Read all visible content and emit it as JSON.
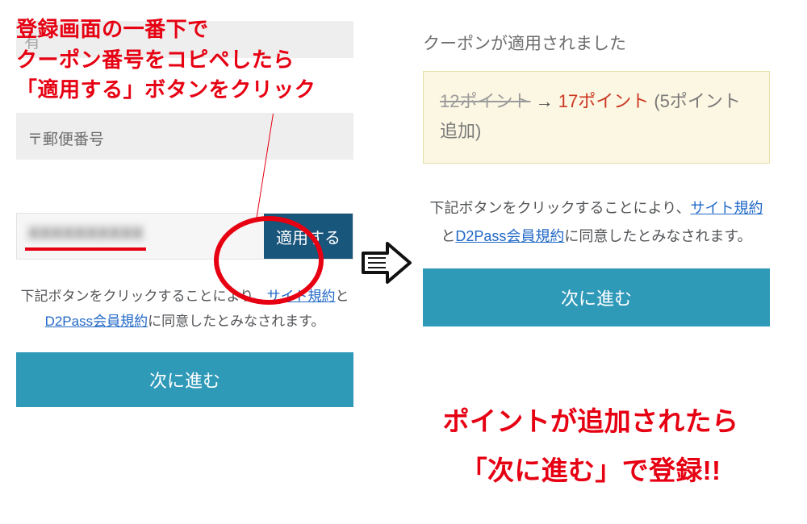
{
  "callouts": {
    "top_line1": "登録画面の一番下で",
    "top_line2": "クーポン番号をコピペしたら",
    "top_line3": "「適用する」ボタンをクリック",
    "bottom_line1": "ポイントが追加されたら",
    "bottom_line2": "「次に進む」で登録!!"
  },
  "left": {
    "postal_placeholder": "〒郵便番号",
    "coupon_placeholder": "XXXXXXXXXX",
    "apply_label": "適用する",
    "terms_prefix": "下記ボタンをクリックすることにより、",
    "terms_link1": "サイト規約",
    "terms_middle": "と",
    "terms_link2": "D2Pass会員規約",
    "terms_suffix": "に同意したとみなされます。",
    "next_label": "次に進む"
  },
  "right": {
    "applied_msg": "クーポンが適用されました",
    "pt_old": "12ポイント",
    "pt_arrow": "→",
    "pt_new": "17ポイント",
    "pt_add": "(5ポイント 追加)",
    "terms_prefix": "下記ボタンをクリックすることにより、",
    "terms_link1": "サイト規約",
    "terms_middle": "と",
    "terms_link2": "D2Pass会員規約",
    "terms_suffix": "に同意したとみなされます。",
    "next_label": "次に進む"
  }
}
